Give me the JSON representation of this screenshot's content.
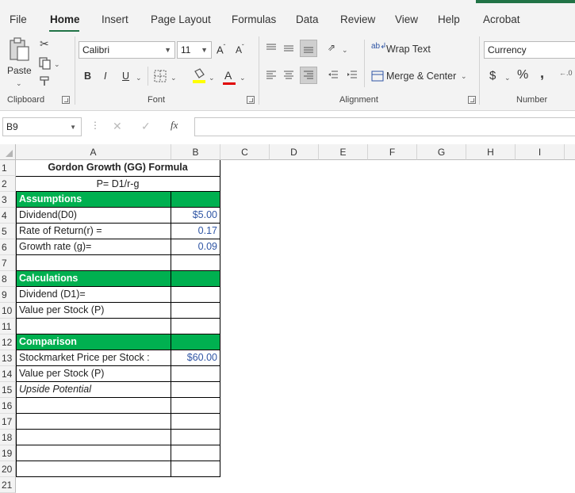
{
  "ribbon": {
    "tabs": [
      "File",
      "Home",
      "Insert",
      "Page Layout",
      "Formulas",
      "Data",
      "Review",
      "View",
      "Help",
      "Acrobat"
    ],
    "active_tab": "Home",
    "clipboard": {
      "paste_label": "Paste",
      "group_label": "Clipboard"
    },
    "font": {
      "name": "Calibri",
      "size": "11",
      "bold": "B",
      "italic": "I",
      "underline": "U",
      "grow": "A",
      "shrink": "A",
      "font_color": "A",
      "group_label": "Font"
    },
    "alignment": {
      "wrap_text": "Wrap Text",
      "merge_center": "Merge & Center",
      "group_label": "Alignment"
    },
    "number": {
      "format": "Currency",
      "currency_symbol": "$",
      "percent": "%",
      "comma": ",",
      "group_label": "Number"
    }
  },
  "formula_bar": {
    "name_box": "B9",
    "fx": "fx",
    "formula": ""
  },
  "accent_color": "#217346",
  "header_fill_color": "#00b050",
  "columns": [
    "A",
    "B",
    "C",
    "D",
    "E",
    "F",
    "G",
    "H",
    "I"
  ],
  "row_numbers": [
    "1",
    "2",
    "3",
    "4",
    "5",
    "6",
    "7",
    "8",
    "9",
    "10",
    "11",
    "12",
    "13",
    "14",
    "15",
    "16",
    "17",
    "18",
    "19",
    "20",
    "21"
  ],
  "sheet": {
    "title": "Gordon Growth (GG) Formula",
    "formula": "P= D1/r-g",
    "assumptions_header": "Assumptions",
    "dividend_label": "Dividend(D0)",
    "dividend_value": "$5.00",
    "rate_label": "Rate of Return(r) =",
    "rate_value": "0.17",
    "growth_label": "Growth rate (g)=",
    "growth_value": "0.09",
    "calculations_header": "Calculations",
    "d1_label": "Dividend (D1)=",
    "value_label": "Value per Stock (P)",
    "comparison_header": "Comparison",
    "market_label": "Stockmarket Price per Stock :",
    "market_value": "$60.00",
    "value_label_2": "Value per Stock (P)",
    "upside_label": "Upside Potential"
  }
}
